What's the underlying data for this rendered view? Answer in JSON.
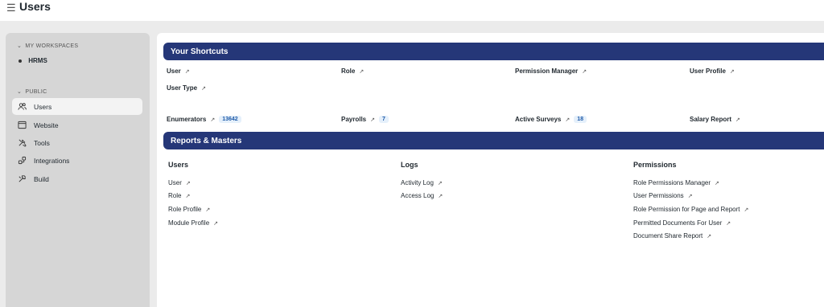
{
  "header": {
    "title": "Users",
    "menu_icon": "hamburger-icon"
  },
  "sidebar": {
    "my_workspaces_label": "MY WORKSPACES",
    "workspaces": [
      {
        "label": "HRMS"
      }
    ],
    "public_label": "PUBLIC",
    "items": [
      {
        "label": "Users",
        "icon": "users-icon",
        "active": true
      },
      {
        "label": "Website",
        "icon": "website-icon",
        "active": false
      },
      {
        "label": "Tools",
        "icon": "tools-icon",
        "active": false
      },
      {
        "label": "Integrations",
        "icon": "integrations-icon",
        "active": false
      },
      {
        "label": "Build",
        "icon": "build-icon",
        "active": false
      }
    ]
  },
  "shortcuts": {
    "title": "Your Shortcuts",
    "items": [
      {
        "label": "User"
      },
      {
        "label": "Role"
      },
      {
        "label": "Permission Manager"
      },
      {
        "label": "User Profile"
      },
      {
        "label": "User Type"
      },
      {
        "label": "Enumerators",
        "count": "13642"
      },
      {
        "label": "Payrolls",
        "count": "7"
      },
      {
        "label": "Active Surveys",
        "count": "18"
      },
      {
        "label": "Salary Report"
      }
    ]
  },
  "reports": {
    "title": "Reports & Masters",
    "groups": [
      {
        "title": "Users",
        "links": [
          "User",
          "Role",
          "Role Profile",
          "Module Profile"
        ]
      },
      {
        "title": "Logs",
        "links": [
          "Activity Log",
          "Access Log"
        ]
      },
      {
        "title": "Permissions",
        "links": [
          "Role Permissions Manager",
          "User Permissions",
          "Role Permission for Page and Report",
          "Permitted Documents For User",
          "Document Share Report"
        ]
      }
    ]
  },
  "colors": {
    "band": "#253778",
    "count_bg": "#e5f0fb",
    "count_text": "#1e5aa8"
  },
  "link_arrow": "↗"
}
